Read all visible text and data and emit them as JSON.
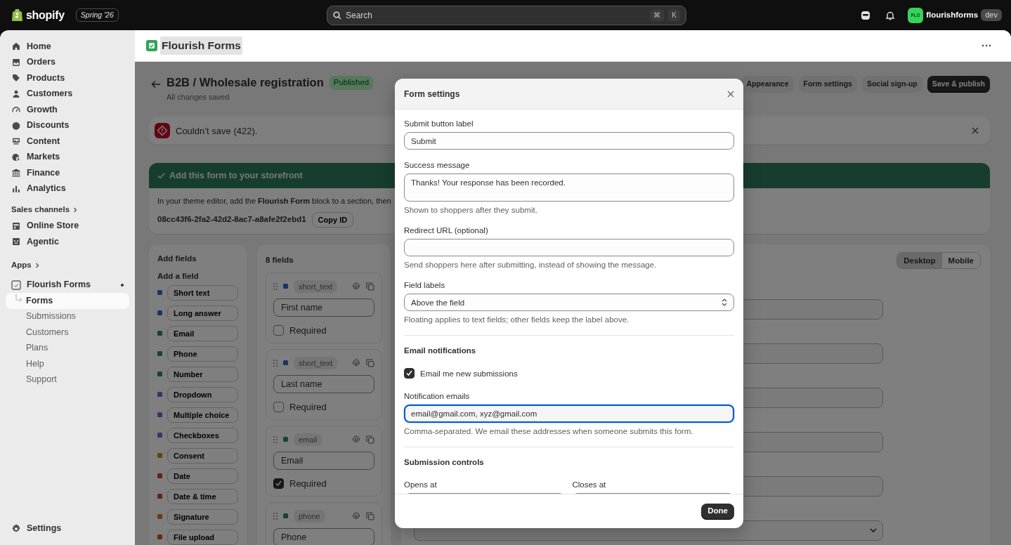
{
  "topbar": {
    "logo": "shopify",
    "edition": "Spring '26",
    "search": {
      "placeholder": "Search",
      "keys": [
        "⌘",
        "K"
      ]
    },
    "store": {
      "avatar": "FLO",
      "name": "flourishforms",
      "badge": "dev"
    }
  },
  "sidebar": {
    "items": [
      {
        "label": "Home",
        "selected": false
      },
      {
        "label": "Orders",
        "selected": false
      },
      {
        "label": "Products",
        "selected": false
      },
      {
        "label": "Customers",
        "selected": false
      },
      {
        "label": "Growth",
        "selected": false
      },
      {
        "label": "Discounts",
        "selected": false
      },
      {
        "label": "Content",
        "selected": false
      },
      {
        "label": "Markets",
        "selected": false
      },
      {
        "label": "Finance",
        "selected": false
      },
      {
        "label": "Analytics",
        "selected": false
      }
    ],
    "sales_channels": {
      "title": "Sales channels",
      "items": [
        {
          "label": "Online Store",
          "selected": false
        },
        {
          "label": "Agentic",
          "selected": false
        }
      ]
    },
    "apps": {
      "title": "Apps",
      "app": {
        "label": "Flourish Forms",
        "items": [
          {
            "label": "Forms",
            "selected": true
          },
          {
            "label": "Submissions",
            "selected": false
          },
          {
            "label": "Customers",
            "selected": false
          },
          {
            "label": "Plans",
            "selected": false
          },
          {
            "label": "Help",
            "selected": false
          },
          {
            "label": "Support",
            "selected": false
          }
        ]
      }
    },
    "settings": "Settings"
  },
  "app_header": {
    "title": "Flourish Forms"
  },
  "page": {
    "title": "B2B / Wholesale registration",
    "status": "Published",
    "subtitle": "All changes saved",
    "actions": [
      {
        "label": "Appearance",
        "kind": "secondary"
      },
      {
        "label": "Form settings",
        "kind": "secondary"
      },
      {
        "label": "Social sign-up",
        "kind": "secondary"
      },
      {
        "label": "Save & publish",
        "kind": "primary"
      }
    ]
  },
  "banner": {
    "kind": "error",
    "message": "Couldn’t save (422)."
  },
  "storefront": {
    "title": "Add this form to your storefront",
    "text": "In your theme editor, add the **Flourish Form** block to a section, then",
    "form_id": "08cc43f6-2fa2-42d2-8ac7-a8afe2f2ebd1",
    "copy_button": "Copy ID"
  },
  "palette": {
    "title": "Add fields",
    "subtitle": "Add a field",
    "types": [
      {
        "label": "Short text",
        "color": "#163765"
      },
      {
        "label": "Long answer",
        "color": "#163765"
      },
      {
        "label": "Email",
        "color": "#18452f"
      },
      {
        "label": "Phone",
        "color": "#18452f"
      },
      {
        "label": "Number",
        "color": "#18452f"
      },
      {
        "label": "Dropdown",
        "color": "#452e68"
      },
      {
        "label": "Multiple choice",
        "color": "#452e68"
      },
      {
        "label": "Checkboxes",
        "color": "#452e68"
      },
      {
        "label": "Consent",
        "color": "#604509"
      },
      {
        "label": "Date",
        "color": "#642215"
      },
      {
        "label": "Date & time",
        "color": "#642215"
      },
      {
        "label": "Signature",
        "color": "#6d3815"
      },
      {
        "label": "File upload",
        "color": "#612c0d"
      }
    ]
  },
  "fields": {
    "count": "8 fields",
    "items": [
      {
        "type": "short_text",
        "color": "#163765",
        "value": "First name",
        "required": false,
        "check_label": "Required"
      },
      {
        "type": "short_text",
        "color": "#163765",
        "value": "Last name",
        "required": false,
        "check_label": "Required"
      },
      {
        "type": "email",
        "color": "#18452f",
        "value": "Email",
        "required": true,
        "check_label": "Required"
      },
      {
        "type": "phone",
        "color": "#18452f",
        "value": "Phone"
      }
    ]
  },
  "preview": {
    "modes": [
      {
        "label": "Desktop",
        "selected": true
      },
      {
        "label": "Mobile",
        "selected": false
      }
    ],
    "inputs": [
      {
        "kind": "text"
      },
      {
        "kind": "text"
      },
      {
        "kind": "text"
      },
      {
        "kind": "text"
      },
      {
        "kind": "text"
      },
      {
        "kind": "select"
      }
    ]
  },
  "modal": {
    "title": "Form settings",
    "fields": [
      {
        "kind": "text",
        "label": "Submit button label",
        "value": "Submit"
      },
      {
        "kind": "textarea",
        "label": "Success message",
        "value": "Thanks! Your response has been recorded.",
        "help": "Shown to shoppers after they submit."
      },
      {
        "kind": "text",
        "label": "Redirect URL (optional)",
        "help": "Send shoppers here after submitting, instead of showing the message."
      },
      {
        "kind": "select",
        "label": "Field labels",
        "value": "Above the field",
        "help": "Floating applies to text fields; other fields keep the label above."
      },
      {
        "kind": "heading",
        "text": "Email notifications"
      },
      {
        "kind": "checkbox",
        "label": "Email me new submissions",
        "checked": true
      },
      {
        "kind": "text",
        "label": "Notification emails",
        "value": "email@gmail.com, xyz@gmail.com",
        "focused": true,
        "help": "Comma-separated. We email these addresses when someone submits this form."
      },
      {
        "kind": "heading",
        "text": "Submission controls"
      },
      {
        "kind": "date_pair",
        "labels": [
          "Opens at",
          "Closes at"
        ]
      }
    ],
    "done": "Done"
  }
}
